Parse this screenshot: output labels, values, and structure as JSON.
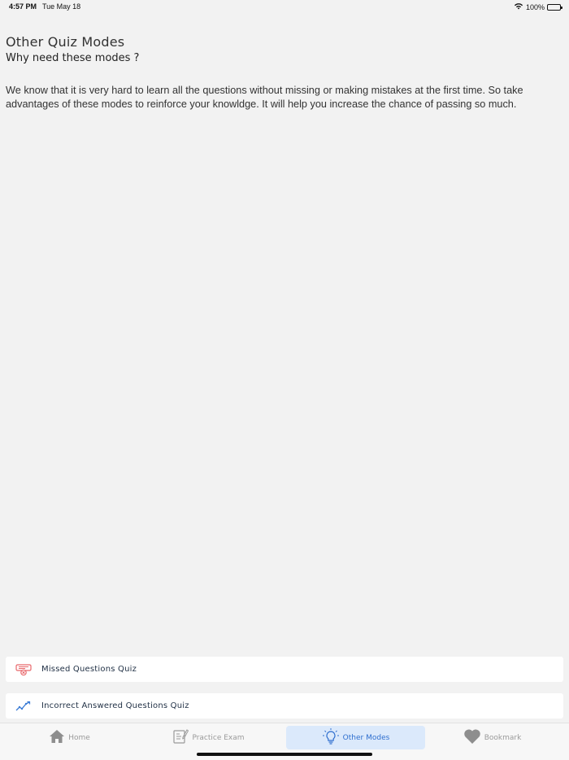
{
  "status_bar": {
    "time": "4:57 PM",
    "date": "Tue May 18",
    "battery": "100%",
    "icons": [
      "wifi-icon",
      "battery-icon"
    ]
  },
  "header": {
    "title": "Other Quiz Modes",
    "subtitle": "Why need these modes ?"
  },
  "description": "We know that it is very hard to learn all the questions without missing or making mistakes at the first time. So take advantages of these modes to reinforce your knowldge. It will help you increase the chance of passing so much.",
  "modes": [
    {
      "label": "Missed Questions Quiz",
      "icon": "missed-questions-icon",
      "color": "#e8676b"
    },
    {
      "label": "Incorrect Answered Questions Quiz",
      "icon": "trend-chart-icon",
      "color": "#3a7bd5"
    }
  ],
  "tabs": [
    {
      "label": "Home",
      "icon": "home-icon",
      "active": false
    },
    {
      "label": "Practice Exam",
      "icon": "practice-exam-icon",
      "active": false
    },
    {
      "label": "Other Modes",
      "icon": "lightbulb-icon",
      "active": true
    },
    {
      "label": "Bookmark",
      "icon": "heart-icon",
      "active": false
    }
  ],
  "colors": {
    "background": "#f2f2f2",
    "active_tab_bg": "#dbe9fb",
    "active_tab_text": "#2f6fcf",
    "inactive_tab_text": "#9a9a9a"
  }
}
